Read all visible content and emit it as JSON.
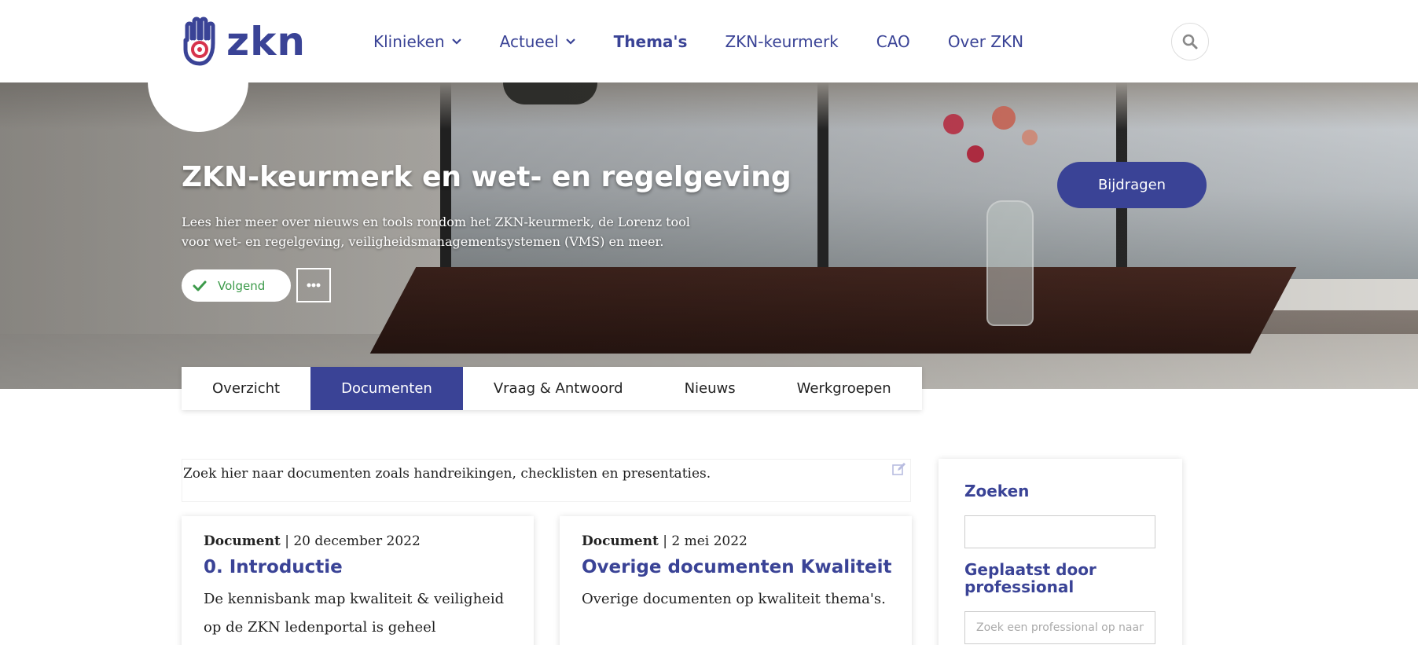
{
  "header": {
    "logo_text": "zkn",
    "nav": [
      {
        "label": "Klinieken",
        "dropdown": true
      },
      {
        "label": "Actueel",
        "dropdown": true
      },
      {
        "label": "Thema's",
        "active": true
      },
      {
        "label": "ZKN-keurmerk"
      },
      {
        "label": "CAO"
      },
      {
        "label": "Over ZKN"
      }
    ],
    "search_icon": "search-icon"
  },
  "hero": {
    "title": "ZKN-keurmerk en wet- en regelgeving",
    "description": "Lees hier meer over nieuws en tools rondom het ZKN-keurmerk, de Lorenz tool voor wet- en regelgeving, veiligheidsmanagementsystemen (VMS) en meer.",
    "follow_label": "Volgend",
    "contribute_label": "Bijdragen"
  },
  "tabs": [
    {
      "label": "Overzicht"
    },
    {
      "label": "Documenten",
      "active": true
    },
    {
      "label": "Vraag & Antwoord"
    },
    {
      "label": "Nieuws"
    },
    {
      "label": "Werkgroepen"
    }
  ],
  "intro": {
    "text": "Zoek hier naar documenten zoals handreikingen, checklisten en presentaties."
  },
  "cards": [
    {
      "type": "Document",
      "date": "20 december 2022",
      "title": "0. Introductie",
      "body": "De kennisbank map kwaliteit & veiligheid op de ZKN ledenportal is geheel vernieuwd. Alle"
    },
    {
      "type": "Document",
      "date": "2 mei 2022",
      "title": "Overige documenten Kwaliteit",
      "body": "Overige documenten op kwaliteit thema's."
    }
  ],
  "sidebar": {
    "search_heading": "Zoeken",
    "search_value": "",
    "professional_heading": "Geplaatst door professional",
    "professional_placeholder": "Zoek een professional op naam"
  },
  "colors": {
    "brand": "#3a4396",
    "follow_green": "#3c9a4a",
    "logo_accent": "#d6334c"
  }
}
